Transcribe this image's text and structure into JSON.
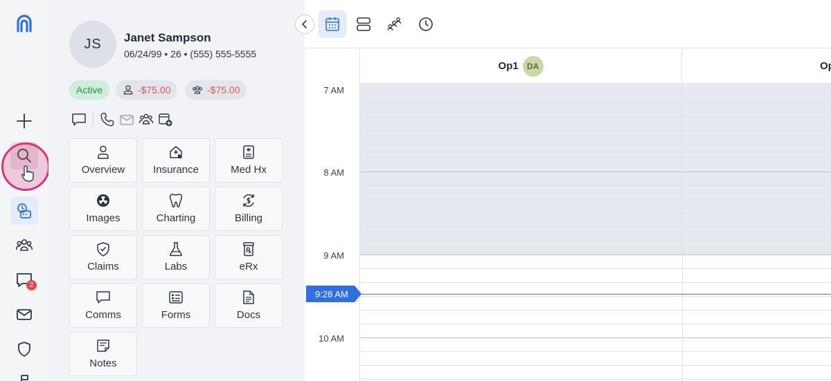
{
  "rail": {
    "badge_count": "2",
    "accent": "#2f6fe4"
  },
  "patient": {
    "initials": "JS",
    "name": "Janet Sampson",
    "meta": "06/24/99 • 26 • (555) 555-5555",
    "status": "Active",
    "patient_balance": "-$75.00",
    "family_balance": "-$75.00"
  },
  "tiles": [
    {
      "label": "Overview",
      "icon": "person-icon"
    },
    {
      "label": "Insurance",
      "icon": "insurance-icon"
    },
    {
      "label": "Med Hx",
      "icon": "medical-history-icon"
    },
    {
      "label": "Images",
      "icon": "radiation-icon"
    },
    {
      "label": "Charting",
      "icon": "tooth-icon"
    },
    {
      "label": "Billing",
      "icon": "billing-icon"
    },
    {
      "label": "Claims",
      "icon": "shield-check-icon"
    },
    {
      "label": "Labs",
      "icon": "flask-icon"
    },
    {
      "label": "eRx",
      "icon": "prescription-icon"
    },
    {
      "label": "Comms",
      "icon": "chat-icon"
    },
    {
      "label": "Forms",
      "icon": "form-icon"
    },
    {
      "label": "Docs",
      "icon": "document-icon"
    },
    {
      "label": "Notes",
      "icon": "note-icon"
    }
  ],
  "calendar": {
    "columns": [
      {
        "label": "Op1",
        "badge": "DA"
      },
      {
        "label": "Op",
        "badge": ""
      }
    ],
    "times": [
      "7 AM",
      "8 AM",
      "9 AM",
      "10 AM"
    ],
    "now": "9:28 AM"
  }
}
